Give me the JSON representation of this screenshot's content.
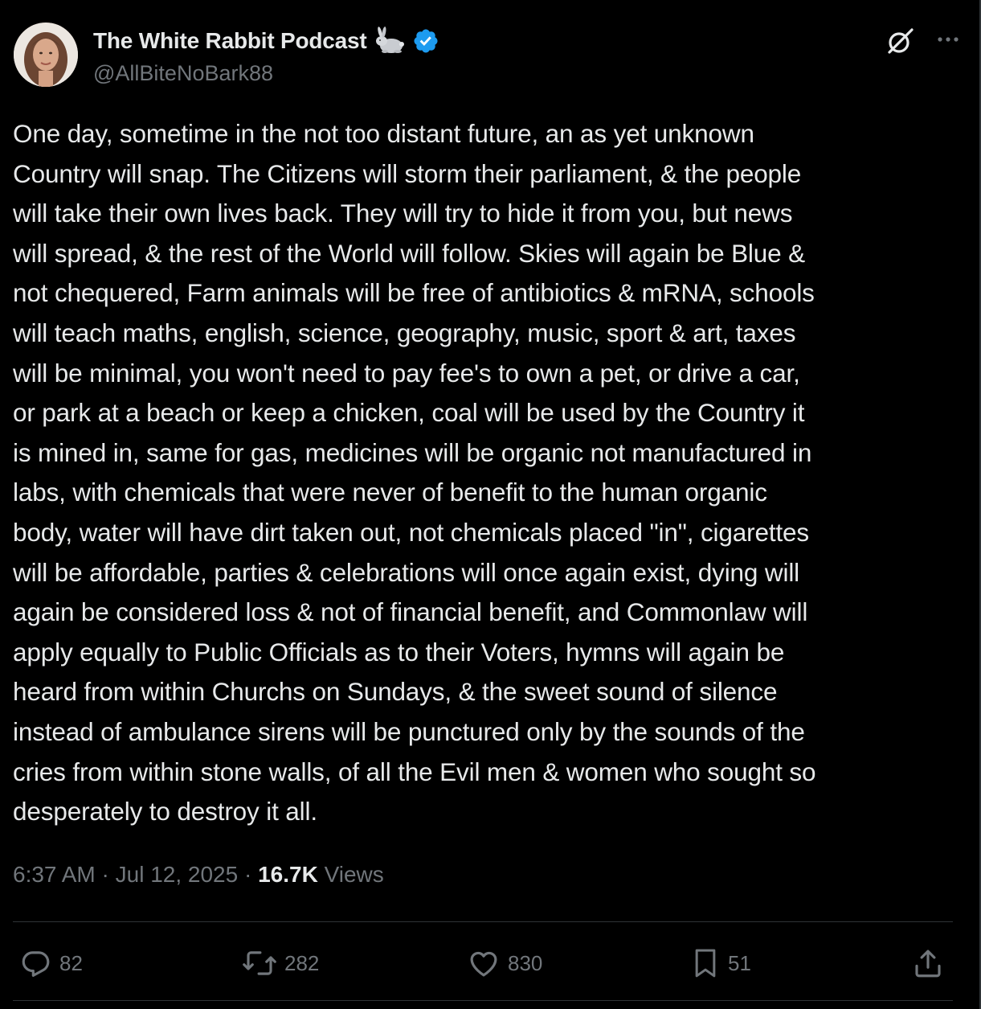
{
  "author": {
    "display_name": "The White Rabbit Podcast",
    "handle": "@AllBiteNoBark88",
    "emoji": "rabbit",
    "verified": true
  },
  "header_icons": [
    "grok-icon",
    "more-icon"
  ],
  "tweet": {
    "text": "One day, sometime in the not too distant future, an as yet unknown\nCountry will snap. The Citizens will storm their parliament, & the people\nwill take their own lives back. They will try to hide it from you, but news\nwill spread, & the rest of the World will follow. Skies will again be Blue &\nnot chequered, Farm animals will be free of antibiotics & mRNA, schools\nwill teach maths, english, science, geography, music, sport & art, taxes\nwill be minimal, you won't need to pay fee's to own a pet, or drive a car,\nor park at a beach or keep a chicken, coal will be used by the Country it\nis mined in, same for gas, medicines will be organic not manufactured in\nlabs, with chemicals that were never of benefit to the human organic\nbody, water will have dirt taken out, not chemicals placed \"in\", cigarettes\nwill be affordable, parties & celebrations will once again exist, dying will\nagain be considered loss & not of financial benefit, and Commonlaw will\napply equally to Public Officials as to their Voters, hymns will again be\nheard from within Churchs on Sundays, & the sweet sound of silence\ninstead of ambulance sirens will be punctured only by the sounds of the\ncries from within stone walls, of all the Evil men & women who sought so\ndesperately to destroy it all."
  },
  "meta": {
    "time": "6:37 AM",
    "separator": " · ",
    "date": "Jul 12, 2025",
    "views_count": "16.7K",
    "views_label": " Views"
  },
  "actions": {
    "replies": "82",
    "reposts": "282",
    "likes": "830",
    "bookmarks": "51"
  },
  "colors": {
    "background": "#000000",
    "text": "#e7e9ea",
    "secondary": "#71767b",
    "border": "#2f3336",
    "verified": "#1d9bf0"
  }
}
